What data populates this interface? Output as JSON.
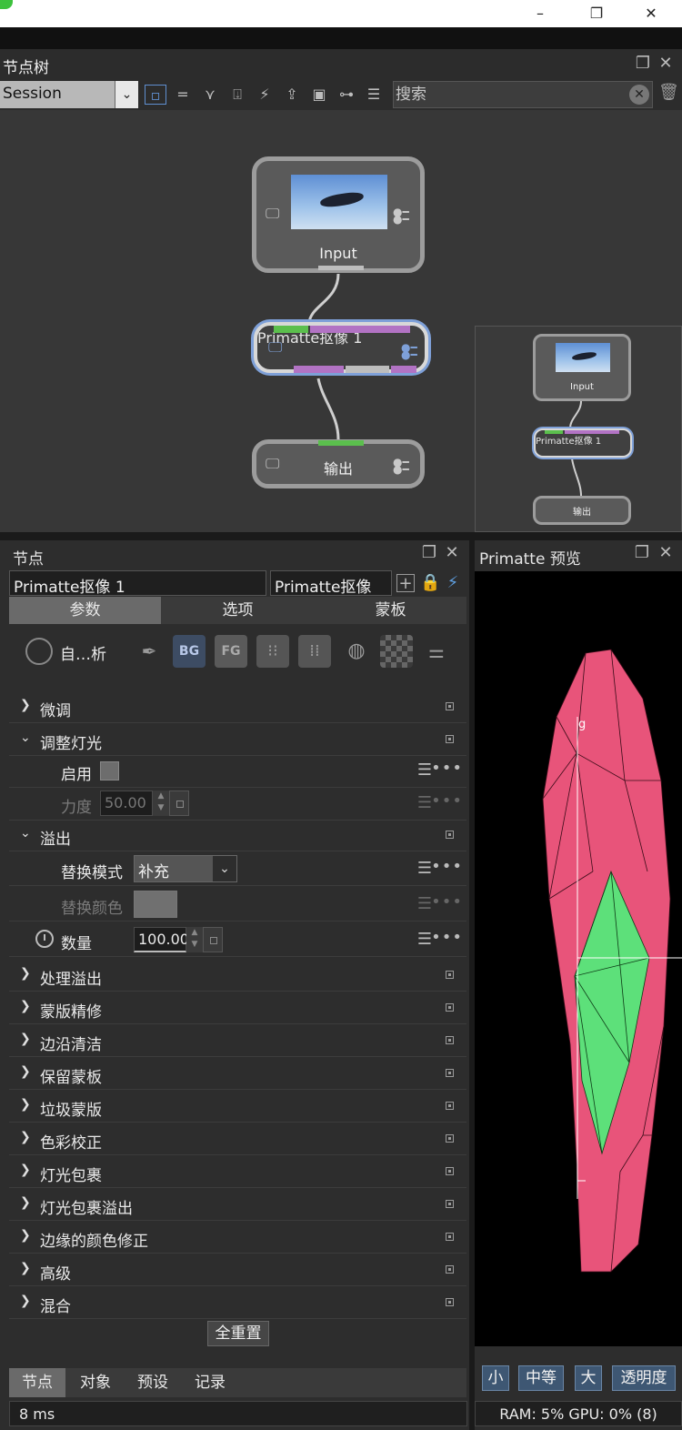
{
  "window": {
    "minimize": "–",
    "maximize": "❐",
    "close": "✕"
  },
  "node_tree": {
    "title": "节点树",
    "session_value": "Session",
    "search_placeholder": "搜索",
    "icons": [
      "layout-icon",
      "align-icon",
      "tree-icon",
      "upload-icon",
      "bolt-icon",
      "folder-up-icon",
      "save-icon",
      "link-icon",
      "list-icon"
    ],
    "nodes": {
      "input_label": "Input",
      "keyer_label": "Primatte抠像 1",
      "output_label": "输出"
    },
    "minimap": {
      "input_label": "Input",
      "keyer_label": "Primatte抠像 1",
      "output_label": "输出"
    }
  },
  "node_panel": {
    "title": "节点",
    "node_name": "Primatte抠像 1",
    "node_type": "Primatte抠像",
    "tabs": [
      "参数",
      "选项",
      "蒙板"
    ],
    "auto_analyze_label": "自…析",
    "tool_bg": "BG",
    "tool_fg": "FG",
    "sections": [
      {
        "label": "微调",
        "expanded": false
      },
      {
        "label": "调整灯光",
        "expanded": true
      },
      {
        "label": "溢出",
        "expanded": true
      },
      {
        "label": "处理溢出",
        "expanded": false
      },
      {
        "label": "蒙版精修",
        "expanded": false
      },
      {
        "label": "边沿清洁",
        "expanded": false
      },
      {
        "label": "保留蒙板",
        "expanded": false
      },
      {
        "label": "垃圾蒙版",
        "expanded": false
      },
      {
        "label": "色彩校正",
        "expanded": false
      },
      {
        "label": "灯光包裹",
        "expanded": false
      },
      {
        "label": "灯光包裹溢出",
        "expanded": false
      },
      {
        "label": "边缘的颜色修正",
        "expanded": false
      },
      {
        "label": "高级",
        "expanded": false
      },
      {
        "label": "混合",
        "expanded": false
      }
    ],
    "props": {
      "enable_label": "启用",
      "strength_label": "力度",
      "strength_value": "50.00",
      "replace_mode_label": "替换模式",
      "replace_mode_value": "补充",
      "replace_color_label": "替换颜色",
      "amount_label": "数量",
      "amount_value": "100.00"
    },
    "reset_label": "全重置",
    "bottom_tabs": [
      "节点",
      "对象",
      "预设",
      "记录"
    ],
    "status_text": "8 ms"
  },
  "preview": {
    "title": "Primatte 预览",
    "axis_label": "g",
    "buttons": [
      "小",
      "中等",
      "大",
      "透明度"
    ],
    "ram_text": "RAM: 5% GPU: 0% (8)"
  },
  "colors": {
    "accent": "#7ea0d8",
    "hull_pink": "#e8547a",
    "hull_green": "#5de07a",
    "port_green": "#5bbf4d",
    "port_purple": "#b273c4"
  }
}
